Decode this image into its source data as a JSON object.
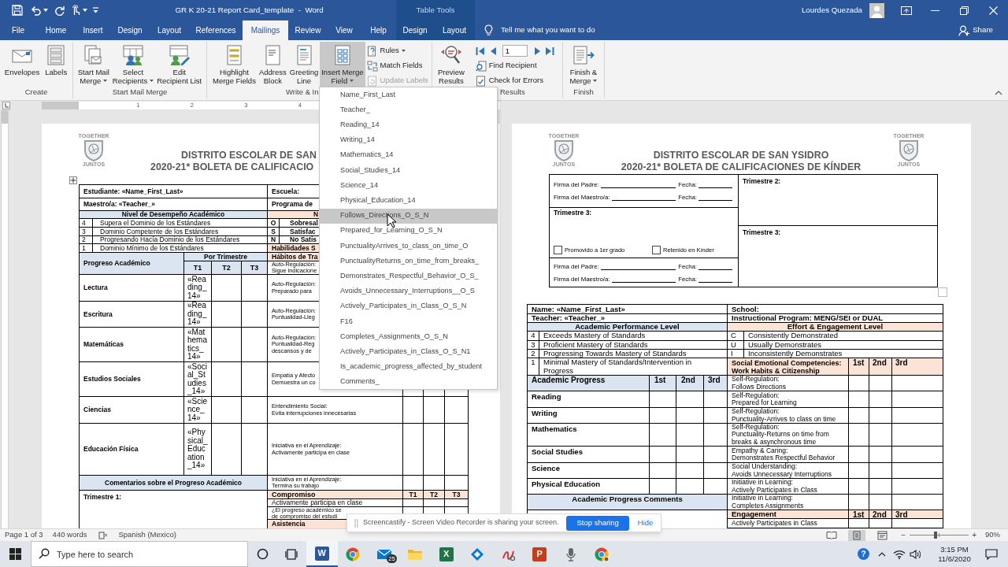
{
  "title_bar": {
    "title": "GR K 20-21 Report Card_template  -  Word",
    "context_label": "Table Tools",
    "user_name": "Lourdes Quezada"
  },
  "ribbon_tabs": [
    {
      "label": "File",
      "selected": false,
      "contextual": false
    },
    {
      "label": "Home",
      "selected": false,
      "contextual": false
    },
    {
      "label": "Insert",
      "selected": false,
      "contextual": false
    },
    {
      "label": "Design",
      "selected": false,
      "contextual": false
    },
    {
      "label": "Layout",
      "selected": false,
      "contextual": false
    },
    {
      "label": "References",
      "selected": false,
      "contextual": false
    },
    {
      "label": "Mailings",
      "selected": true,
      "contextual": false
    },
    {
      "label": "Review",
      "selected": false,
      "contextual": false
    },
    {
      "label": "View",
      "selected": false,
      "contextual": false
    },
    {
      "label": "Help",
      "selected": false,
      "contextual": false
    },
    {
      "label": "Design",
      "selected": false,
      "contextual": true
    },
    {
      "label": "Layout",
      "selected": false,
      "contextual": true
    }
  ],
  "tell_me": "Tell me what you want to do",
  "share_button": "Share",
  "ribbon_groups": [
    {
      "label": "Create",
      "items": [
        {
          "kind": "large",
          "lines": [
            "Envelopes"
          ],
          "dropdown": false,
          "pressed": false
        },
        {
          "kind": "large",
          "lines": [
            "Labels"
          ],
          "dropdown": false,
          "pressed": false
        }
      ]
    },
    {
      "label": "Start Mail Merge",
      "items": [
        {
          "kind": "large",
          "lines": [
            "Start Mail",
            "Merge"
          ],
          "dropdown": true,
          "pressed": false
        },
        {
          "kind": "large",
          "lines": [
            "Select",
            "Recipients"
          ],
          "dropdown": true,
          "pressed": false
        },
        {
          "kind": "large",
          "lines": [
            "Edit",
            "Recipient List"
          ],
          "dropdown": false,
          "pressed": false
        }
      ]
    },
    {
      "label": "Write & In",
      "items": [
        {
          "kind": "large",
          "lines": [
            "Highlight",
            "Merge Fields"
          ],
          "dropdown": false,
          "pressed": false
        },
        {
          "kind": "large",
          "lines": [
            "Address",
            "Block"
          ],
          "dropdown": false,
          "pressed": false
        },
        {
          "kind": "large",
          "lines": [
            "Greeting",
            "Line"
          ],
          "dropdown": false,
          "pressed": false
        },
        {
          "kind": "large",
          "lines": [
            "Insert Merge",
            "Field"
          ],
          "dropdown": true,
          "pressed": true
        },
        {
          "kind": "stack",
          "rows": [
            {
              "kind": "button",
              "label": "Rules",
              "dropdown": true,
              "disabled": false
            },
            {
              "kind": "button",
              "label": "Match Fields",
              "dropdown": false,
              "disabled": false
            },
            {
              "kind": "button",
              "label": "Update Labels",
              "dropdown": false,
              "disabled": true
            }
          ]
        }
      ]
    },
    {
      "label": "Results",
      "items": [
        {
          "kind": "large",
          "lines": [
            "Preview",
            "Results"
          ],
          "dropdown": false,
          "pressed": false
        },
        {
          "kind": "stack",
          "rows": [
            {
              "kind": "nav",
              "record": "1"
            },
            {
              "kind": "button",
              "label": "Find Recipient",
              "dropdown": false,
              "disabled": false
            },
            {
              "kind": "button",
              "label": "Check for Errors",
              "dropdown": false,
              "disabled": false
            }
          ]
        }
      ]
    },
    {
      "label": "Finish",
      "items": [
        {
          "kind": "large",
          "lines": [
            "Finish &",
            "Merge"
          ],
          "dropdown": true,
          "pressed": false
        }
      ]
    }
  ],
  "ruler": {
    "numbers": [
      "1",
      "2",
      "3",
      "4"
    ]
  },
  "left_page": {
    "logo": {
      "top": "TOGETHER",
      "bottom": "JUNTOS"
    },
    "heading": [
      "DISTRITO ESCOLAR DE SAN",
      "2020-21* BOLETA DE CALIFICACIO"
    ],
    "info_rows": [
      {
        "left": "Estudiante: «Name_First_Last»",
        "right": "Escuela:"
      },
      {
        "left": "Maestro/a: «Teacher_»",
        "right": "Programa de"
      }
    ],
    "level_headers": {
      "left": "Nivel de Desempeño Académico",
      "right": "N"
    },
    "levels": [
      {
        "number": "4",
        "text": "Supera el Dominio de los Estándares"
      },
      {
        "number": "3",
        "text": "Dominio Competente de los Estándares"
      },
      {
        "number": "2",
        "text": "Progresando Hacía Dominio de los Estándares"
      },
      {
        "number": "1",
        "text": "Dominio Mínimo de los Estándares"
      }
    ],
    "effort_levels": [
      {
        "code": "O",
        "text": "Sobresal"
      },
      {
        "code": "S",
        "text": "Satisfac"
      },
      {
        "code": "N",
        "text": "No Satis"
      }
    ],
    "skills_headers": [
      "Habilidades S",
      "Hábitos de Tra"
    ],
    "progress_header": {
      "label": "Progreso Académico",
      "group": "Por Trimestre",
      "terms": [
        "T1",
        "T2",
        "T3"
      ]
    },
    "subjects": [
      {
        "name": "Lectura",
        "t1": "«Reading_14»"
      },
      {
        "name": "Escritura",
        "t1": "«Reading_14»"
      },
      {
        "name": "Matemáticas",
        "t1": "«Mathematics_14»"
      },
      {
        "name": "Estudios Sociales",
        "t1": "«Social_Studies_14»"
      },
      {
        "name": "Ciencias",
        "t1": "«Science_14»"
      },
      {
        "name": "Educación Física",
        "t1": "«Physical_Education_14»"
      }
    ],
    "comments_header": "Comentarios sobre el Progreso Académico",
    "comments_label": "Trimestre 1:",
    "skills": [
      [
        "Auto-Regulación:",
        "Sigue indicacione"
      ],
      [
        "Auto-Regulación:",
        "Preparado para"
      ],
      [
        "Auto-Regulación:",
        "Puntualidad-Lleg"
      ],
      [
        "Auto-Regulación:",
        "Puntualidad-Reg",
        "descansos y de"
      ],
      [
        "Empatía y Afecto",
        "Demuestra un co"
      ],
      [
        "Entendimiento Social:",
        "Evita interrupciones innecesarias"
      ],
      [
        "Iniciativa en el Aprendizaje:",
        "Activamente participa en clase"
      ],
      [
        "Iniciativa en el Aprendizaje:",
        "Termina su trabajo"
      ]
    ],
    "engagement": {
      "header": "Compromiso",
      "terms": [
        "T1",
        "T2",
        "T3"
      ],
      "rows": [
        [
          "Activamente participa en clase"
        ],
        [
          "¿El progreso académico se",
          "de compromiso del estudi"
        ]
      ]
    },
    "attendance_header": "Asistencia"
  },
  "merge_field_menu": {
    "items": [
      {
        "label": "Name_First_Last",
        "selected": false
      },
      {
        "label": "Teacher_",
        "selected": false
      },
      {
        "label": "Reading_14",
        "selected": false
      },
      {
        "label": "Writing_14",
        "selected": false
      },
      {
        "label": "Mathematics_14",
        "selected": false
      },
      {
        "label": "Social_Studies_14",
        "selected": false
      },
      {
        "label": "Science_14",
        "selected": false
      },
      {
        "label": "Physical_Education_14",
        "selected": false
      },
      {
        "label": "Follows_Directions_O_S_N",
        "selected": true
      },
      {
        "label": "Prepared_for_Learning_O_S_N",
        "selected": false
      },
      {
        "label": "PunctualityArrives_to_class_on_time_O",
        "selected": false
      },
      {
        "label": "PunctualityReturns_on_time_from_breaks_",
        "selected": false
      },
      {
        "label": "Demonstrates_Respectful_Behavior_O_S_",
        "selected": false
      },
      {
        "label": "Avoids_Unnecessary_Interruptions__O_S",
        "selected": false
      },
      {
        "label": "Actively_Participates_in_Class_O_S_N",
        "selected": false
      },
      {
        "label": "F16",
        "selected": false
      },
      {
        "label": "Completes_Assignments_O_S_N",
        "selected": false
      },
      {
        "label": "Actively_Participates_in_Class_O_S_N1",
        "selected": false
      },
      {
        "label": "Is_academic_progress_affected_by_student",
        "selected": false
      },
      {
        "label": "Comments_",
        "selected": false
      }
    ]
  },
  "right_page": {
    "logos": [
      {
        "top": "TOGETHER",
        "bottom": "JUNTOS"
      },
      {
        "top": "TOGETHER",
        "bottom": "JUNTOS"
      }
    ],
    "heading": [
      "DISTRITO ESCOLAR DE SAN YSIDRO",
      "2020-21* BOLETA DE CALIFICACIONES DE KÍNDER"
    ],
    "signature_box": {
      "upper_signatures": [
        {
          "label": "Firma del Padre:",
          "date_label": "Fecha:"
        },
        {
          "label": "Firma del Maestro/a:",
          "date_label": "Fecha:"
        }
      ],
      "decision_label": "Trimestre 3:",
      "checkboxes": [
        {
          "label": "Promovido a 1er grado",
          "checked": false
        },
        {
          "label": "Retenido en Kínder",
          "checked": false
        }
      ],
      "lower_signatures": [
        {
          "label": "Firma del Padre:",
          "date_label": "Fecha:"
        },
        {
          "label": "Firma del Maestro/a:",
          "date_label": "Fecha:"
        }
      ],
      "comment_labels": [
        "Trimestre 2:",
        "Trimestre 3:"
      ]
    },
    "info_rows": [
      {
        "left": "Name: «Name_First_Last»",
        "right": "School:"
      },
      {
        "left": "Teacher: «Teacher_»",
        "right": "Instructional Program: MENG/SEI or DUAL"
      }
    ],
    "level_headers": {
      "left": "Academic Performance Level",
      "right": "Effort & Engagement Level"
    },
    "levels": [
      {
        "number": "4",
        "text": "Exceeds Mastery of Standards",
        "code": "C",
        "code_text": "Consistently Demonstrated"
      },
      {
        "number": "3",
        "text": "Proficient Mastery of Standards",
        "code": "U",
        "code_text": "Usually Demonstrates"
      },
      {
        "number": "2",
        "text": "Progressing Towards Mastery of Standards",
        "code": "I",
        "code_text": "Inconsistently Demonstrates"
      },
      {
        "number": "1",
        "text": "Minimal Mastery of Standards/Intervention in Progress"
      }
    ],
    "competencies_header": {
      "lines": [
        "Social Emotional Competencies:",
        "Work Habits & Citizenship"
      ],
      "terms": [
        "1st",
        "2nd",
        "3rd"
      ]
    },
    "progress_header": {
      "label": "Academic Progress",
      "terms": [
        "1st",
        "2nd",
        "3rd"
      ]
    },
    "subjects": [
      "Reading",
      "Writing",
      "Mathematics",
      "Social Studies",
      "Science",
      "Physical Education"
    ],
    "comments_header": "Academic Progress Comments",
    "competencies": [
      [
        "Self-Regulation:",
        "Follows Directions"
      ],
      [
        "Self-Regulation:",
        "Prepared for Learning"
      ],
      [
        "Self-Regulation:",
        "Punctuality-Arrives to class on time"
      ],
      [
        "Self-Regulation:",
        "Punctuality-Returns on time from breaks & asynchronous time"
      ],
      [
        "Empathy & Caring:",
        "Demonstrates Respectful Behavior"
      ],
      [
        "Social Understanding:",
        "Avoids Unnecessary Interruptions"
      ],
      [
        "Initiative in Learning:",
        "Actively Participates in Class"
      ],
      [
        "Initiative in Learning:",
        "Completes Assignments"
      ]
    ],
    "engagement": {
      "header": "Engagement",
      "terms": [
        "1st",
        "2nd",
        "3rd"
      ],
      "rows": [
        "Actively Participates in Class"
      ]
    }
  },
  "screen_share_bar": {
    "message": "Screencastify - Screen Video Recorder is sharing your screen.",
    "stop_button": "Stop sharing",
    "hide_link": "Hide"
  },
  "status_bar": {
    "page": "Page 1 of 3",
    "words": "440 words",
    "language": "Spanish (Mexico)",
    "views": [
      {
        "kind": "read",
        "selected": false
      },
      {
        "kind": "print",
        "selected": true
      },
      {
        "kind": "web",
        "selected": false
      }
    ],
    "zoom_out": "−",
    "zoom": {
      "level": 0.44
    },
    "zoom_in": "+",
    "zoom_percent": "90%"
  },
  "taskbar": {
    "search": {
      "placeholder": "Type here to search"
    },
    "apps": [
      {
        "kind": "document",
        "glyph": "W",
        "selected": true
      },
      {
        "kind": "browser",
        "selected": false
      },
      {
        "kind": "mail",
        "badge": "25",
        "selected": false
      },
      {
        "kind": "folder",
        "selected": false
      },
      {
        "kind": "spreadsheet",
        "glyph": "X",
        "selected": false
      },
      {
        "kind": "diamond",
        "selected": false
      },
      {
        "kind": "scribble",
        "selected": false
      },
      {
        "kind": "slides",
        "glyph": "P",
        "selected": false
      },
      {
        "kind": "microphone",
        "selected": false
      },
      {
        "kind": "browser_profile",
        "selected": false
      }
    ],
    "help_glyph": "?",
    "time": "3:15 PM",
    "date": "11/6/2020"
  }
}
